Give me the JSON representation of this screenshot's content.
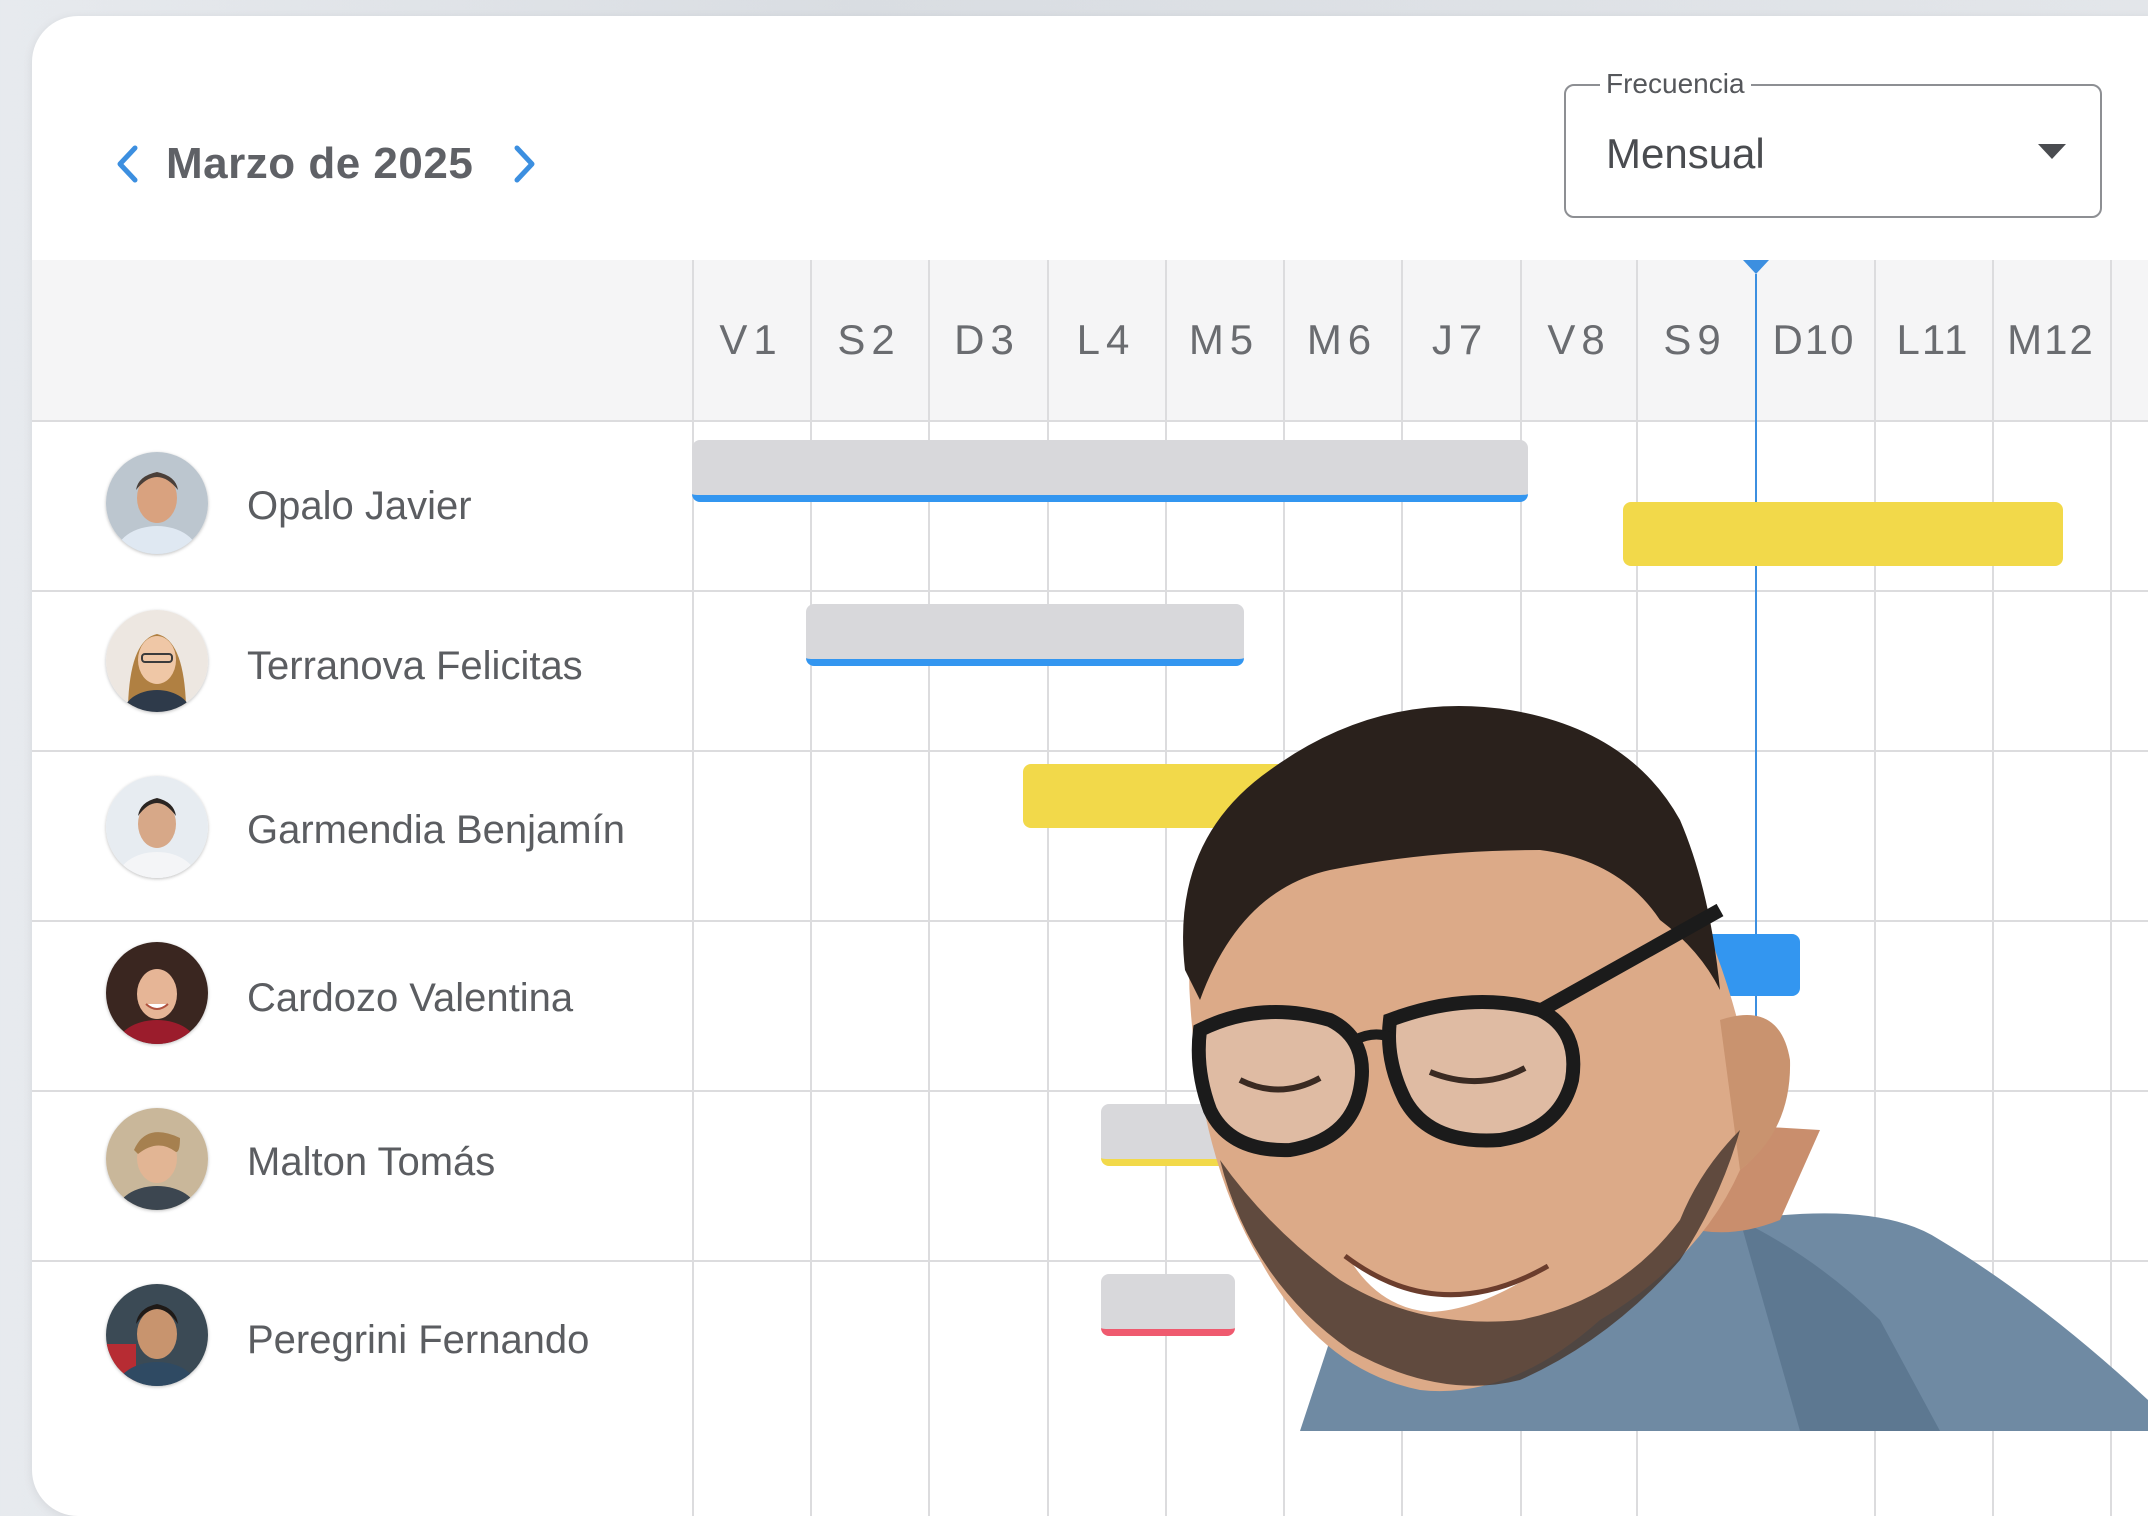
{
  "header": {
    "title": "Marzo de 2025",
    "prev_icon": "chevron-left-icon",
    "next_icon": "chevron-right-icon"
  },
  "frequency": {
    "label": "Frecuencia",
    "value": "Mensual",
    "icon": "caret-down-icon"
  },
  "days": [
    "V1",
    "S2",
    "D3",
    "L4",
    "M5",
    "M6",
    "J7",
    "V8",
    "S9",
    "D10",
    "L11",
    "M12"
  ],
  "today": "D10",
  "people": [
    {
      "name": "Opalo Javier"
    },
    {
      "name": "Terranova Felicitas"
    },
    {
      "name": "Garmendia Benjamín"
    },
    {
      "name": "Cardozo Valentina"
    },
    {
      "name": "Malton Tomás"
    },
    {
      "name": "Peregrini Fernando"
    }
  ],
  "colors": {
    "accent": "#3c8fe0",
    "bar_gray": "#d8d8db",
    "status_blue": "#3396f0",
    "status_yellow": "#f2d94a",
    "status_red": "#ef5a6f",
    "title_text": "#5f6166"
  }
}
